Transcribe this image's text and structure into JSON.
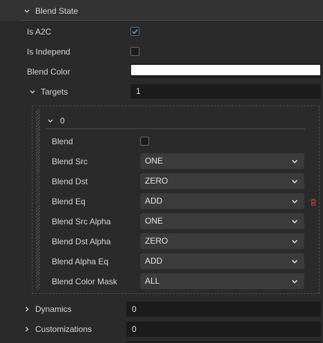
{
  "blend_state": {
    "title": "Blend State",
    "is_a2c_label": "Is A2C",
    "is_a2c_checked": true,
    "is_independ_label": "Is Independ",
    "is_independ_checked": false,
    "blend_color_label": "Blend Color",
    "blend_color_value": "#ffffff",
    "targets_label": "Targets",
    "targets_value": "1"
  },
  "target_0": {
    "header": "0",
    "blend_label": "Blend",
    "blend_checked": false,
    "rows": [
      {
        "label": "Blend Src",
        "value": "ONE"
      },
      {
        "label": "Blend Dst",
        "value": "ZERO"
      },
      {
        "label": "Blend Eq",
        "value": "ADD"
      },
      {
        "label": "Blend Src Alpha",
        "value": "ONE"
      },
      {
        "label": "Blend Dst Alpha",
        "value": "ZERO"
      },
      {
        "label": "Blend Alpha Eq",
        "value": "ADD"
      },
      {
        "label": "Blend Color Mask",
        "value": "ALL"
      }
    ]
  },
  "dynamics": {
    "label": "Dynamics",
    "value": "0"
  },
  "customizations": {
    "label": "Customizations",
    "value": "0"
  },
  "icons": {
    "expanded": "chevron-down-icon",
    "collapsed": "chevron-right-icon",
    "dropdown": "chevron-down-icon",
    "delete": "trash-icon",
    "check": "check-icon"
  },
  "colors": {
    "background": "#2a2a2a",
    "field_background": "#1b1b1b",
    "select_background": "#3b3b3b",
    "checkbox_accent": "#4a9be8",
    "delete_icon": "#c0392b"
  }
}
